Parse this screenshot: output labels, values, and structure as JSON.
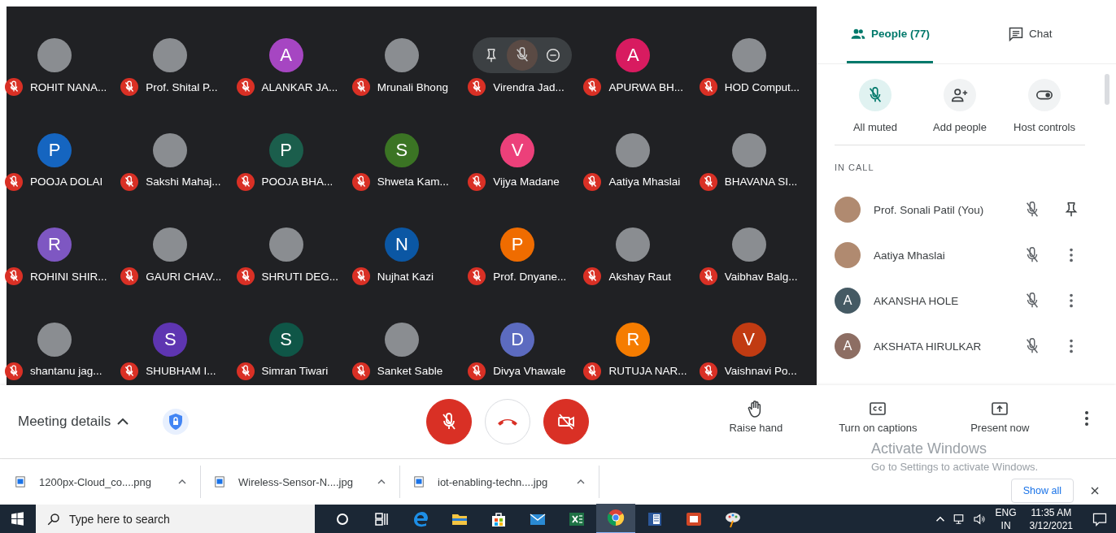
{
  "tiles": [
    {
      "name": "ROHIT NANA...",
      "avatar": {
        "kind": "photo"
      },
      "muted": true
    },
    {
      "name": "Prof. Shital P...",
      "avatar": {
        "kind": "photo"
      },
      "muted": true
    },
    {
      "name": "ALANKAR JA...",
      "avatar": {
        "kind": "letter",
        "letter": "A",
        "color": "#a646c2"
      },
      "muted": true
    },
    {
      "name": "Mrunali Bhong",
      "avatar": {
        "kind": "photo"
      },
      "muted": true
    },
    {
      "name": "Virendra Jad...",
      "avatar": {
        "kind": "hover_controls"
      },
      "muted": true
    },
    {
      "name": "APURWA BH...",
      "avatar": {
        "kind": "letter",
        "letter": "A",
        "color": "#d81b60"
      },
      "muted": true
    },
    {
      "name": "HOD Comput...",
      "avatar": {
        "kind": "photo"
      },
      "muted": true
    },
    {
      "name": "POOJA DOLAI",
      "avatar": {
        "kind": "letter",
        "letter": "P",
        "color": "#1565c0"
      },
      "muted": true
    },
    {
      "name": "Sakshi Mahaj...",
      "avatar": {
        "kind": "photo"
      },
      "muted": true
    },
    {
      "name": "POOJA BHA...",
      "avatar": {
        "kind": "letter",
        "letter": "P",
        "color": "#1b5e4c"
      },
      "muted": true
    },
    {
      "name": "Shweta Kam...",
      "avatar": {
        "kind": "letter",
        "letter": "S",
        "color": "#3b7424"
      },
      "muted": true
    },
    {
      "name": "Vijya Madane",
      "avatar": {
        "kind": "letter",
        "letter": "V",
        "color": "#ec407a"
      },
      "muted": true
    },
    {
      "name": "Aatiya Mhaslai",
      "avatar": {
        "kind": "photo"
      },
      "muted": true
    },
    {
      "name": "BHAVANA SI...",
      "avatar": {
        "kind": "photo"
      },
      "muted": true
    },
    {
      "name": "ROHINI SHIR...",
      "avatar": {
        "kind": "letter",
        "letter": "R",
        "color": "#7e57c2"
      },
      "muted": true
    },
    {
      "name": "GAURI CHAV...",
      "avatar": {
        "kind": "photo"
      },
      "muted": true
    },
    {
      "name": "SHRUTI DEG...",
      "avatar": {
        "kind": "photo"
      },
      "muted": true
    },
    {
      "name": "Nujhat Kazi",
      "avatar": {
        "kind": "letter",
        "letter": "N",
        "color": "#0b57a4"
      },
      "muted": true
    },
    {
      "name": "Prof. Dnyane...",
      "avatar": {
        "kind": "letter",
        "letter": "P",
        "color": "#ef6c00"
      },
      "muted": true
    },
    {
      "name": "Akshay Raut",
      "avatar": {
        "kind": "photo"
      },
      "muted": true
    },
    {
      "name": "Vaibhav Balg...",
      "avatar": {
        "kind": "photo"
      },
      "muted": true
    },
    {
      "name": "shantanu jag...",
      "avatar": {
        "kind": "photo"
      },
      "muted": true
    },
    {
      "name": "SHUBHAM I...",
      "avatar": {
        "kind": "letter",
        "letter": "S",
        "color": "#5e35b1"
      },
      "muted": true
    },
    {
      "name": "Simran Tiwari",
      "avatar": {
        "kind": "letter",
        "letter": "S",
        "color": "#0f5647"
      },
      "muted": true
    },
    {
      "name": "Sanket Sable",
      "avatar": {
        "kind": "photo"
      },
      "muted": true
    },
    {
      "name": "Divya Vhawale",
      "avatar": {
        "kind": "letter",
        "letter": "D",
        "color": "#5c6bc0"
      },
      "muted": true
    },
    {
      "name": "RUTUJA NAR...",
      "avatar": {
        "kind": "letter",
        "letter": "R",
        "color": "#f57c00"
      },
      "muted": true
    },
    {
      "name": "Vaishnavi Po...",
      "avatar": {
        "kind": "letter",
        "letter": "V",
        "color": "#c13b12"
      },
      "muted": true
    }
  ],
  "panel": {
    "tabs": [
      {
        "label": "People (77)",
        "kind": "people",
        "selected": true
      },
      {
        "label": "Chat",
        "kind": "chat",
        "selected": false
      }
    ],
    "actions": [
      {
        "label": "All muted",
        "kind": "mute",
        "active": true
      },
      {
        "label": "Add people",
        "kind": "add",
        "active": false
      },
      {
        "label": "Host controls",
        "kind": "host",
        "active": false
      }
    ],
    "section": "IN CALL",
    "people": [
      {
        "name": "Prof. Sonali Patil (You)",
        "avatar": {
          "kind": "photo"
        },
        "muted": true,
        "kind": "pin"
      },
      {
        "name": "Aatiya Mhaslai",
        "avatar": {
          "kind": "photo"
        },
        "muted": true,
        "kind": "more"
      },
      {
        "name": "AKANSHA HOLE",
        "avatar": {
          "kind": "letter",
          "letter": "A",
          "color": "#455a64"
        },
        "muted": true,
        "kind": "more"
      },
      {
        "name": "AKSHATA HIRULKAR",
        "avatar": {
          "kind": "letter",
          "letter": "A",
          "color": "#8d6e63"
        },
        "muted": true,
        "kind": "more"
      }
    ]
  },
  "controls": {
    "meeting_details": "Meeting details",
    "mic_on": false,
    "camera_on": false,
    "actions": [
      {
        "label": "Raise hand",
        "kind": "hand"
      },
      {
        "label": "Turn on captions",
        "kind": "cc"
      },
      {
        "label": "Present now",
        "kind": "present"
      }
    ]
  },
  "activation": {
    "title": "Activate Windows",
    "hint": "Go to Settings to activate Windows."
  },
  "downloads": {
    "files": [
      "1200px-Cloud_co....png",
      "Wireless-Sensor-N....jpg",
      "iot-enabling-techn....jpg"
    ],
    "show_all": "Show all"
  },
  "taskbar": {
    "search_placeholder": "Type here to search",
    "language": "ENG",
    "region": "IN",
    "time": "11:35 AM",
    "date": "3/12/2021"
  }
}
